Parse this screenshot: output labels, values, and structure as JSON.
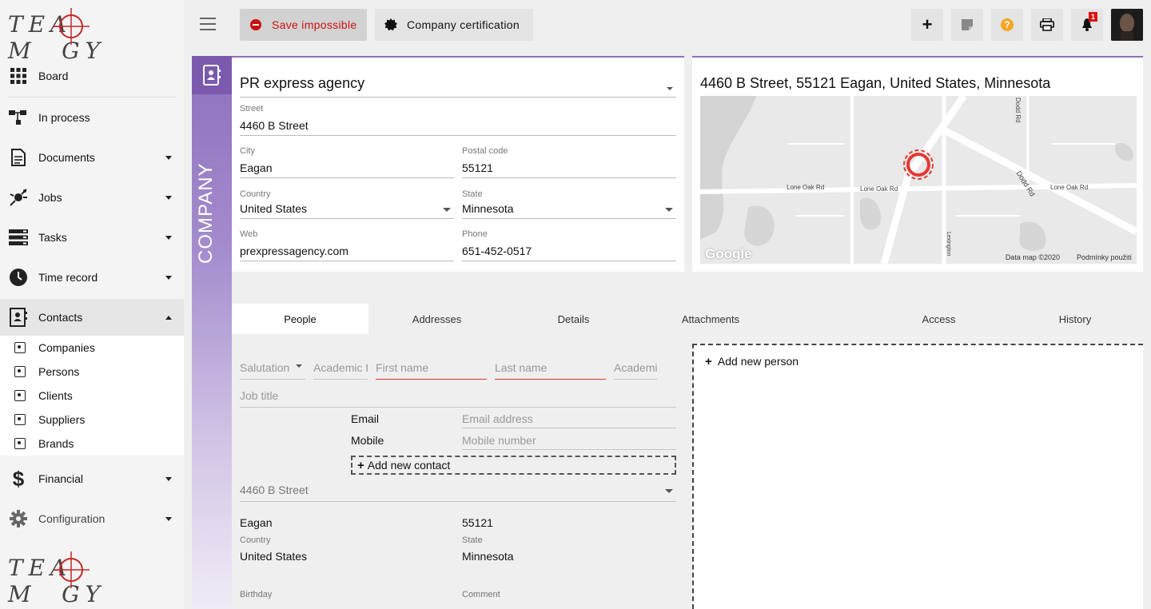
{
  "app": {
    "logo_text": "TEAMOGY"
  },
  "sidebar": {
    "items": [
      {
        "label": "Board"
      },
      {
        "label": "In process"
      },
      {
        "label": "Documents"
      },
      {
        "label": "Jobs"
      },
      {
        "label": "Tasks"
      },
      {
        "label": "Time record"
      },
      {
        "label": "Contacts"
      },
      {
        "label": "Financial"
      },
      {
        "label": "Configuration"
      }
    ],
    "contacts_sub": [
      {
        "label": "Companies"
      },
      {
        "label": "Persons"
      },
      {
        "label": "Clients"
      },
      {
        "label": "Suppliers"
      },
      {
        "label": "Brands"
      }
    ]
  },
  "toolbar": {
    "save_label": "Save impossible",
    "cert_label": "Company certification",
    "notification_count": "1"
  },
  "company": {
    "strip_label": "COMPANY",
    "name": "PR express agency",
    "street_label": "Street",
    "street": "4460  B Street",
    "city_label": "City",
    "city": "Eagan",
    "postal_label": "Postal code",
    "postal": "55121",
    "country_label": "Country",
    "country": "United States",
    "state_label": "State",
    "state": "Minnesota",
    "web_label": "Web",
    "web": "prexpressagency.com",
    "phone_label": "Phone",
    "phone": "651-452-0517"
  },
  "map": {
    "title": "4460 B Street, 55121 Eagan, United States, Minnesota",
    "road_1": "Lone Oak Rd",
    "road_2": "Lone Oak Rd",
    "road_3": "Lone Oak Rd",
    "road_dodd": "Dodd Rd",
    "road_dodd_small": "Dodd Rd",
    "road_lex": "Lexington",
    "google": "Google",
    "data_label": "Data map ©2020",
    "terms_label": "Podmínky použití"
  },
  "tabs": [
    {
      "label": "People"
    },
    {
      "label": "Addresses"
    },
    {
      "label": "Details"
    },
    {
      "label": "Attachments"
    },
    {
      "label": "Access"
    },
    {
      "label": "History"
    }
  ],
  "person_form": {
    "salutation": "Salutation",
    "academic_before": "Academic title",
    "first_name": "First name",
    "last_name": "Last name",
    "academic_after": "Academic",
    "job_title": "Job title",
    "email_label": "Email",
    "email_placeholder": "Email address",
    "mobile_label": "Mobile",
    "mobile_placeholder": "Mobile number",
    "add_contact": "Add new contact",
    "address_select": "4460 B Street",
    "city": "Eagan",
    "postal": "55121",
    "country_label": "Country",
    "country": "United States",
    "state_label": "State",
    "state": "Minnesota",
    "birthday_label": "Birthday",
    "comment_label": "Comment"
  },
  "people_panel": {
    "add_person": "Add new person"
  },
  "colors": {
    "accent": "#8e70bd",
    "danger": "#cc1111",
    "help": "#f5a623"
  }
}
